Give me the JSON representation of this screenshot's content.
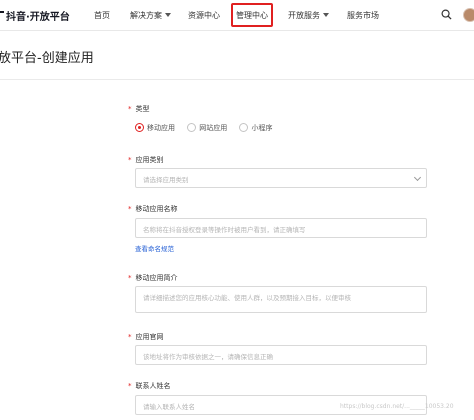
{
  "nav": {
    "brand": "抖音·开放平台",
    "items": [
      "首页",
      "解决方案",
      "资源中心",
      "管理中心",
      "开放服务",
      "服务市场"
    ],
    "active_index": 3,
    "icons": {
      "search": "search-icon",
      "avatar": "avatar"
    }
  },
  "page": {
    "title": "放平台-创建应用"
  },
  "form": {
    "type": {
      "label": "类型",
      "options": [
        "移动应用",
        "网站应用",
        "小程序"
      ],
      "selected": "移动应用"
    },
    "category": {
      "label": "应用类别",
      "placeholder": "请选择应用类别"
    },
    "app_name": {
      "label": "移动应用名称",
      "placeholder": "名称将在抖音授权登录等操作时被用户看到，请正确填写",
      "link": "查看命名规范"
    },
    "intro": {
      "label": "移动应用简介",
      "placeholder": "请详细描述您的应用核心功能、使用人群，以及预期接入目标，以便审核"
    },
    "website": {
      "label": "应用官网",
      "placeholder": "该地址将作为审核依据之一，请确保信息正确"
    },
    "contact": {
      "label": "联系人姓名",
      "placeholder": "请输入联系人姓名"
    }
  },
  "watermark": "https://blog.csdn.net/..._____10053.20"
}
